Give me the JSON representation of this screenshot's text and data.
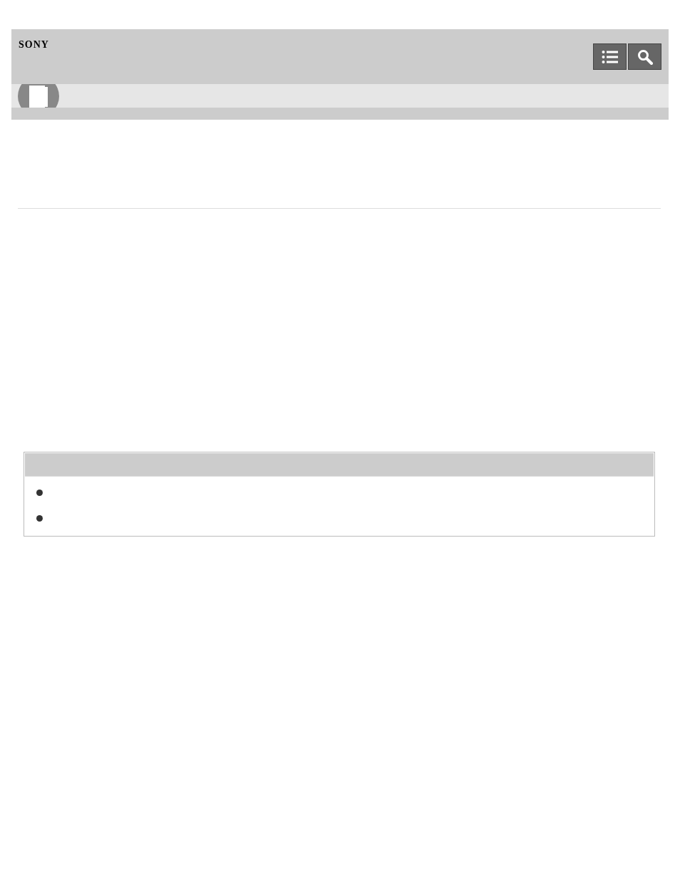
{
  "header": {
    "brand": "SONY",
    "buttons": [
      {
        "kind": "contents"
      },
      {
        "kind": "search"
      }
    ]
  },
  "category_band": {
    "kind": "book"
  },
  "note": {
    "items": [
      {
        "kind": "bullet"
      },
      {
        "kind": "bullet"
      }
    ]
  }
}
